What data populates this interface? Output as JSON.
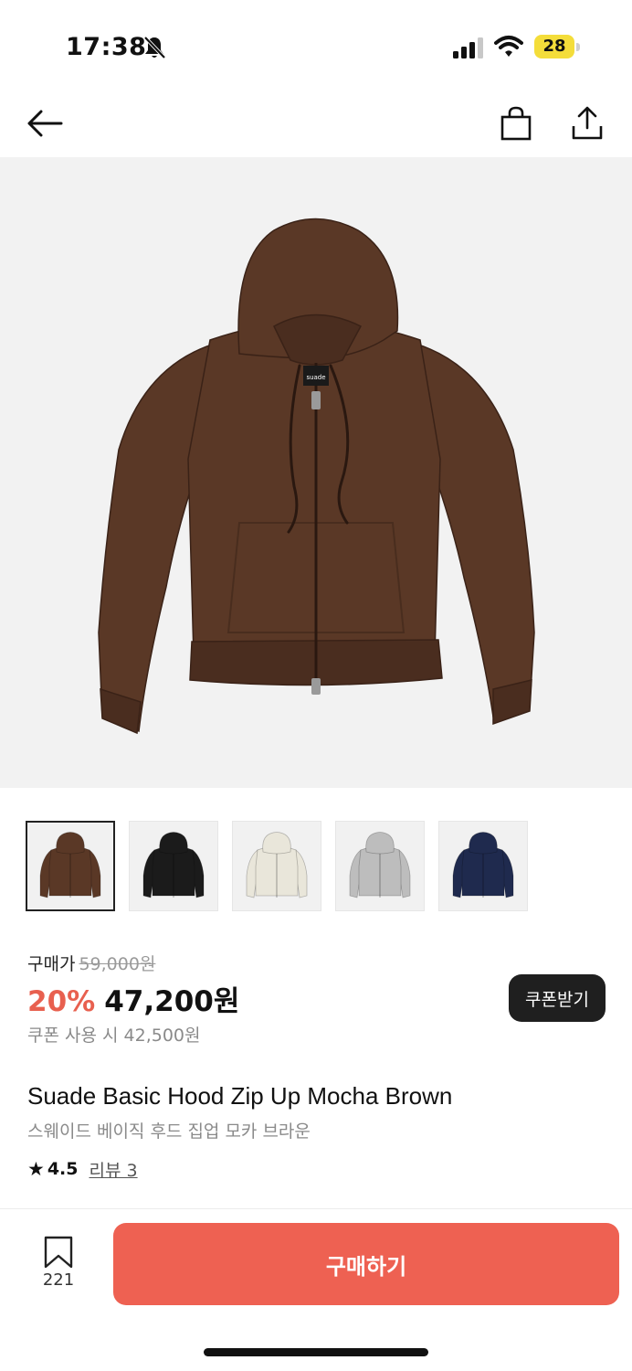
{
  "status_bar": {
    "time": "17:38",
    "battery_level": "28",
    "icons": [
      "bell-slash-icon",
      "signal-bars-icon",
      "wifi-icon",
      "battery-icon"
    ]
  },
  "nav": {
    "icons": [
      "back-arrow-icon",
      "shopping-bag-icon",
      "share-icon"
    ]
  },
  "product": {
    "image_color": "#5a3826",
    "brand_tag": "suade",
    "variants": [
      {
        "color": "#5a3826",
        "selected": true
      },
      {
        "color": "#1b1b1b",
        "selected": false
      },
      {
        "color": "#e9e6da",
        "selected": false
      },
      {
        "color": "#bdbdbd",
        "selected": false
      },
      {
        "color": "#1f2a4e",
        "selected": false
      }
    ],
    "price_label": "구매가",
    "original_price": "59,000원",
    "discount": "20%",
    "sale_price": "47,200원",
    "coupon_price": "쿠폰 사용 시 42,500원",
    "coupon_button": "쿠폰받기",
    "name": "Suade Basic Hood Zip Up Mocha Brown",
    "name_ko": "스웨이드 베이직 후드 집업 모카 브라운",
    "rating": "4.5",
    "review_label": "리뷰 3"
  },
  "bottom_bar": {
    "bookmark_count": "221",
    "buy_button": "구매하기"
  },
  "colors": {
    "accent": "#ee6152",
    "discount": "#e8604f",
    "battery": "#f4dd3a"
  }
}
